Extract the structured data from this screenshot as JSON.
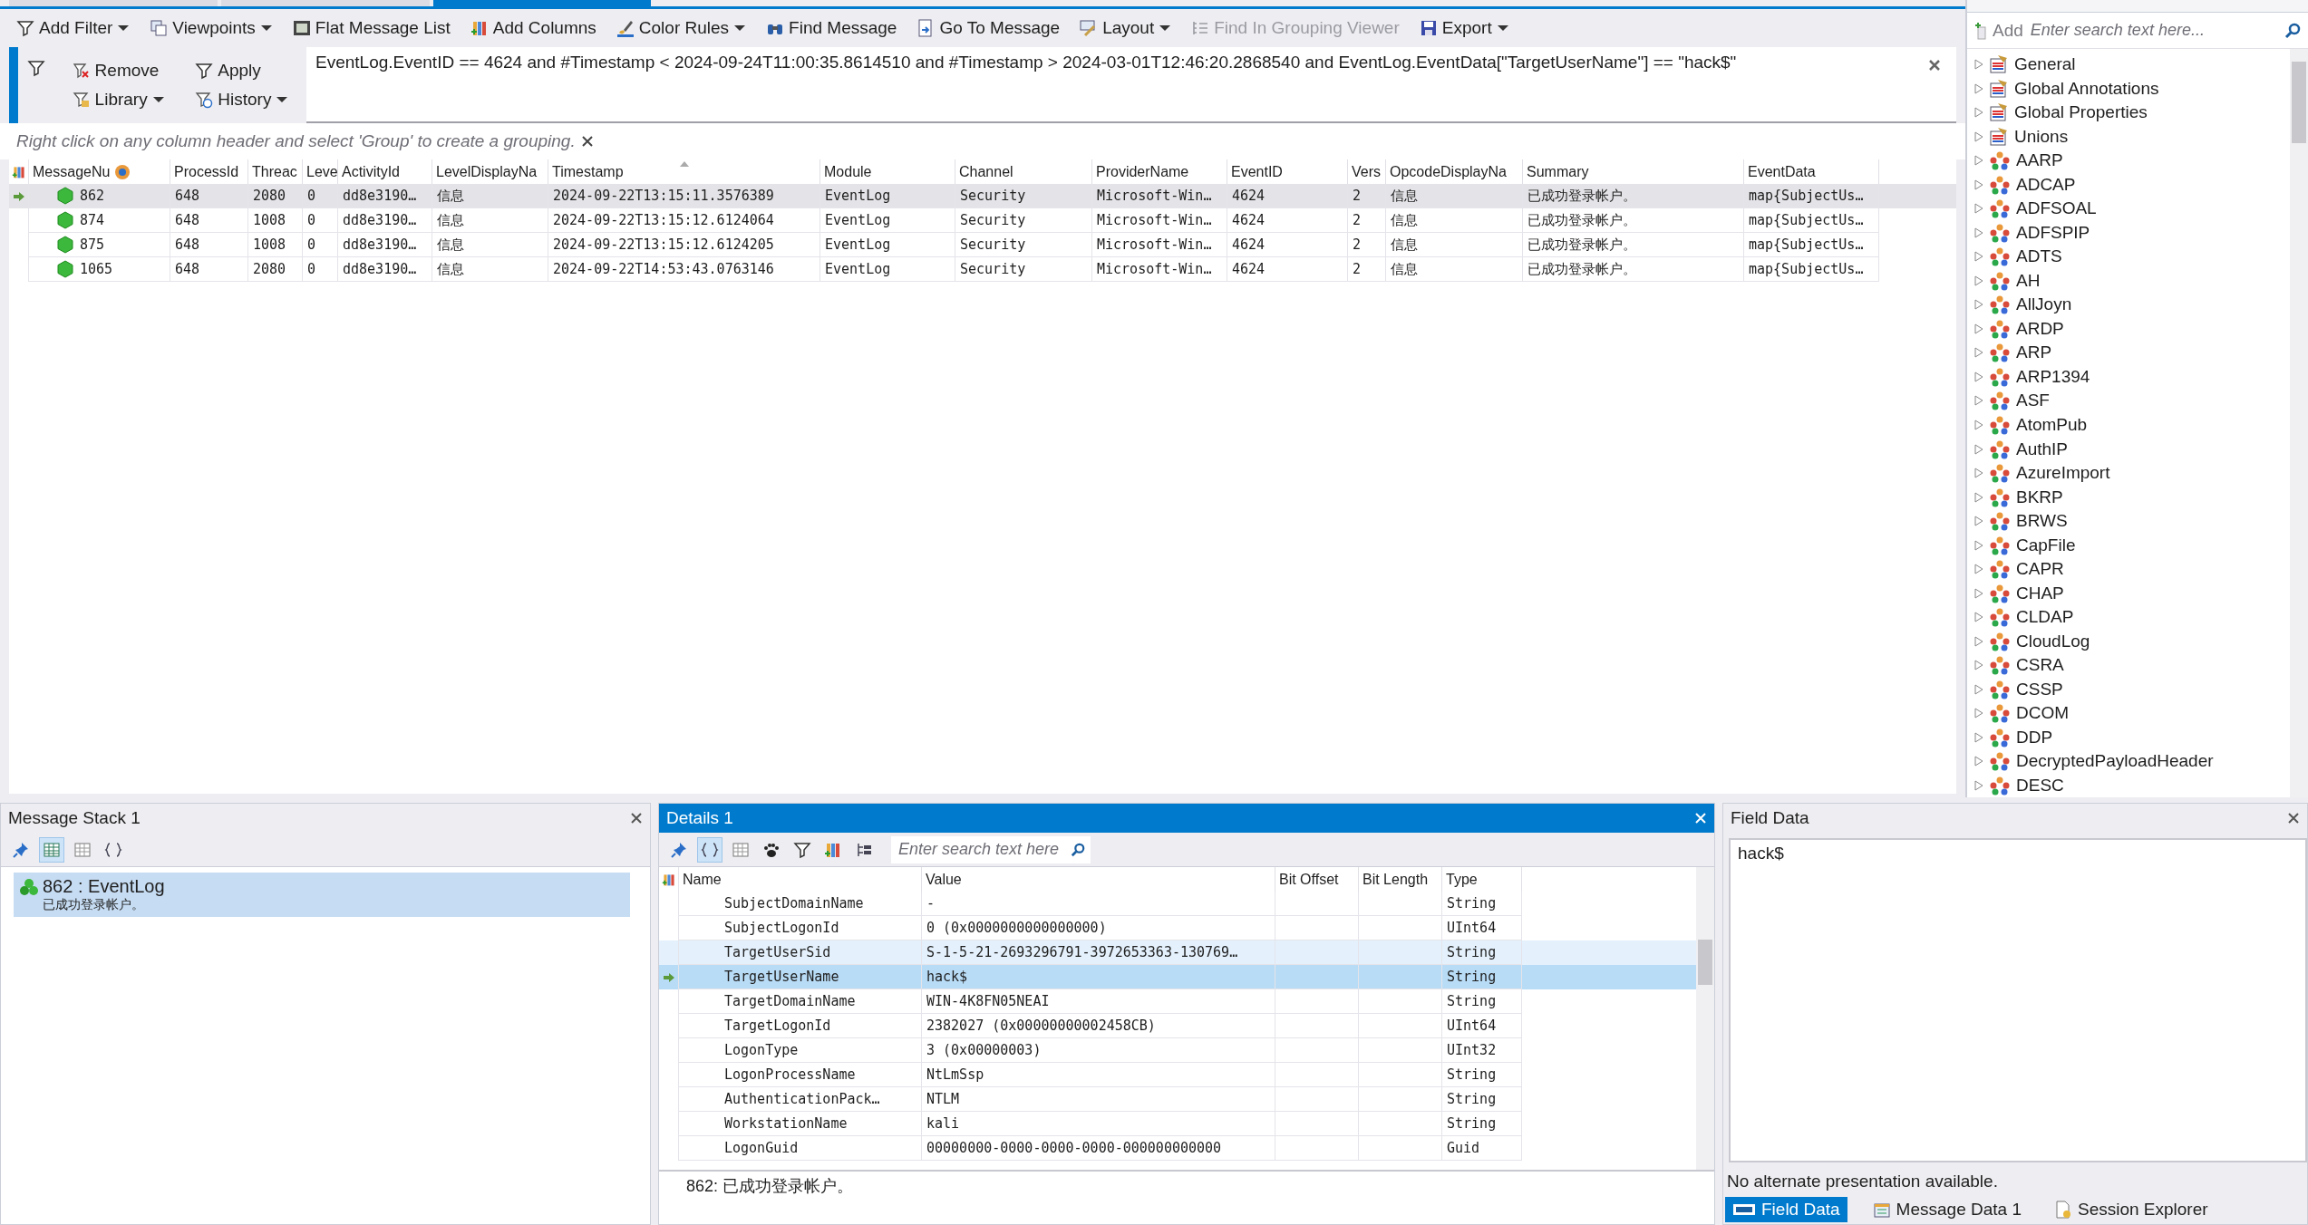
{
  "document_tabs": [
    {
      "selected": false
    },
    {
      "selected": false
    },
    {
      "selected": true
    }
  ],
  "toolbar": {
    "items": [
      {
        "label": "Add Filter",
        "dropdown": true,
        "disabled": false
      },
      {
        "label": "Viewpoints",
        "dropdown": true,
        "disabled": false
      },
      {
        "label": "Flat Message List",
        "dropdown": false,
        "disabled": false
      },
      {
        "label": "Add Columns",
        "dropdown": false,
        "disabled": false
      },
      {
        "label": "Color Rules",
        "dropdown": true,
        "disabled": false
      },
      {
        "label": "Find Message",
        "dropdown": false,
        "disabled": false
      },
      {
        "label": "Go To Message",
        "dropdown": false,
        "disabled": false
      },
      {
        "label": "Layout",
        "dropdown": true,
        "disabled": false
      },
      {
        "label": "Find In Grouping Viewer",
        "dropdown": false,
        "disabled": true
      },
      {
        "label": "Export",
        "dropdown": true,
        "disabled": false
      }
    ]
  },
  "filter_panel": {
    "buttons": [
      {
        "label": "Remove",
        "dropdown": false
      },
      {
        "label": "Apply",
        "dropdown": false
      },
      {
        "label": "Library",
        "dropdown": true
      },
      {
        "label": "History",
        "dropdown": true
      }
    ],
    "expression": "EventLog.EventID == 4624 and #Timestamp < 2024-09-24T11:00:35.8614510 and #Timestamp > 2024-03-01T12:46:20.2868540 and EventLog.EventData[\"TargetUserName\"] == \"hack$\""
  },
  "grouping_hint": "Right click on any column header and select 'Group' to create a grouping.",
  "message_table": {
    "columns": [
      {
        "label": "MessageNu",
        "sorted": false
      },
      {
        "label": "ProcessId",
        "sorted": false
      },
      {
        "label": "Threac",
        "sorted": false
      },
      {
        "label": "Leve",
        "sorted": false
      },
      {
        "label": "ActivityId",
        "sorted": false
      },
      {
        "label": "LevelDisplayNa",
        "sorted": false
      },
      {
        "label": "Timestamp",
        "sorted": true
      },
      {
        "label": "Module",
        "sorted": false
      },
      {
        "label": "Channel",
        "sorted": false
      },
      {
        "label": "ProviderName",
        "sorted": false
      },
      {
        "label": "EventID",
        "sorted": false
      },
      {
        "label": "Vers",
        "sorted": false
      },
      {
        "label": "OpcodeDisplayNa",
        "sorted": false
      },
      {
        "label": "Summary",
        "sorted": false
      },
      {
        "label": "EventData",
        "sorted": false
      }
    ],
    "rows": [
      {
        "selected": true,
        "cells": [
          "862",
          "648",
          "2080",
          "0",
          "dd8e3190…",
          "信息",
          "2024-09-22T13:15:11.3576389",
          "EventLog",
          "Security",
          "Microsoft-Win…",
          "4624",
          "2",
          "信息",
          "已成功登录帐户。",
          "map{SubjectUs…"
        ]
      },
      {
        "selected": false,
        "cells": [
          "874",
          "648",
          "1008",
          "0",
          "dd8e3190…",
          "信息",
          "2024-09-22T13:15:12.6124064",
          "EventLog",
          "Security",
          "Microsoft-Win…",
          "4624",
          "2",
          "信息",
          "已成功登录帐户。",
          "map{SubjectUs…"
        ]
      },
      {
        "selected": false,
        "cells": [
          "875",
          "648",
          "1008",
          "0",
          "dd8e3190…",
          "信息",
          "2024-09-22T13:15:12.6124205",
          "EventLog",
          "Security",
          "Microsoft-Win…",
          "4624",
          "2",
          "信息",
          "已成功登录帐户。",
          "map{SubjectUs…"
        ]
      },
      {
        "selected": false,
        "cells": [
          "1065",
          "648",
          "2080",
          "0",
          "dd8e3190…",
          "信息",
          "2024-09-22T14:53:43.0763146",
          "EventLog",
          "Security",
          "Microsoft-Win…",
          "4624",
          "2",
          "信息",
          "已成功登录帐户。",
          "map{SubjectUs…"
        ]
      }
    ]
  },
  "field_chooser": {
    "add_button": "Add",
    "search": {
      "placeholder": "Enter search text here..."
    },
    "items": [
      {
        "label": "General",
        "kind": "group"
      },
      {
        "label": "Global Annotations",
        "kind": "group"
      },
      {
        "label": "Global Properties",
        "kind": "group"
      },
      {
        "label": "Unions",
        "kind": "group"
      },
      {
        "label": "AARP",
        "kind": "protocol"
      },
      {
        "label": "ADCAP",
        "kind": "protocol"
      },
      {
        "label": "ADFSOAL",
        "kind": "protocol"
      },
      {
        "label": "ADFSPIP",
        "kind": "protocol"
      },
      {
        "label": "ADTS",
        "kind": "protocol"
      },
      {
        "label": "AH",
        "kind": "protocol"
      },
      {
        "label": "AllJoyn",
        "kind": "protocol"
      },
      {
        "label": "ARDP",
        "kind": "protocol"
      },
      {
        "label": "ARP",
        "kind": "protocol"
      },
      {
        "label": "ARP1394",
        "kind": "protocol"
      },
      {
        "label": "ASF",
        "kind": "protocol"
      },
      {
        "label": "AtomPub",
        "kind": "protocol"
      },
      {
        "label": "AuthIP",
        "kind": "protocol"
      },
      {
        "label": "AzureImport",
        "kind": "protocol"
      },
      {
        "label": "BKRP",
        "kind": "protocol"
      },
      {
        "label": "BRWS",
        "kind": "protocol"
      },
      {
        "label": "CapFile",
        "kind": "protocol"
      },
      {
        "label": "CAPR",
        "kind": "protocol"
      },
      {
        "label": "CHAP",
        "kind": "protocol"
      },
      {
        "label": "CLDAP",
        "kind": "protocol"
      },
      {
        "label": "CloudLog",
        "kind": "protocol"
      },
      {
        "label": "CSRA",
        "kind": "protocol"
      },
      {
        "label": "CSSP",
        "kind": "protocol"
      },
      {
        "label": "DCOM",
        "kind": "protocol"
      },
      {
        "label": "DDP",
        "kind": "protocol"
      },
      {
        "label": "DecryptedPayloadHeader",
        "kind": "protocol"
      },
      {
        "label": "DESC",
        "kind": "protocol"
      }
    ]
  },
  "message_stack": {
    "title": "Message Stack 1",
    "tools": [
      {
        "selected": false
      },
      {
        "selected": true
      },
      {
        "selected": false
      },
      {
        "selected": false
      }
    ],
    "items": [
      {
        "title": "862 : EventLog",
        "summary": "已成功登录帐户。",
        "selected": true
      }
    ]
  },
  "details": {
    "title": "Details 1",
    "tools": [
      {
        "selected": false
      },
      {
        "selected": true
      },
      {
        "selected": false
      },
      {
        "selected": false
      },
      {
        "selected": false
      },
      {
        "selected": false
      },
      {
        "selected": false
      }
    ],
    "search": {
      "placeholder": "Enter search text here"
    },
    "columns": [
      "Name",
      "Value",
      "Bit Offset",
      "Bit Length",
      "Type"
    ],
    "rows": [
      {
        "name": "SubjectDomainName",
        "value": "-",
        "type": "String",
        "selected": false,
        "highlighted": false
      },
      {
        "name": "SubjectLogonId",
        "value": "0 (0x0000000000000000)",
        "type": "UInt64",
        "selected": false,
        "highlighted": false
      },
      {
        "name": "TargetUserSid",
        "value": "S-1-5-21-2693296791-3972653363-130769…",
        "type": "String",
        "selected": false,
        "highlighted": true
      },
      {
        "name": "TargetUserName",
        "value": "hack$",
        "type": "String",
        "selected": true,
        "highlighted": false
      },
      {
        "name": "TargetDomainName",
        "value": "WIN-4K8FN05NEAI",
        "type": "String",
        "selected": false,
        "highlighted": false
      },
      {
        "name": "TargetLogonId",
        "value": "2382027 (0x00000000002458CB)",
        "type": "UInt64",
        "selected": false,
        "highlighted": false
      },
      {
        "name": "LogonType",
        "value": "3 (0x00000003)",
        "type": "UInt32",
        "selected": false,
        "highlighted": false
      },
      {
        "name": "LogonProcessName",
        "value": "NtLmSsp",
        "type": "String",
        "selected": false,
        "highlighted": false
      },
      {
        "name": "AuthenticationPack…",
        "value": "NTLM",
        "type": "String",
        "selected": false,
        "highlighted": false
      },
      {
        "name": "WorkstationName",
        "value": "kali",
        "type": "String",
        "selected": false,
        "highlighted": false
      },
      {
        "name": "LogonGuid",
        "value": "00000000-0000-0000-0000-000000000000",
        "type": "Guid",
        "selected": false,
        "highlighted": false
      }
    ],
    "description": "862: 已成功登录帐户。"
  },
  "field_data": {
    "title": "Field Data",
    "value": "hack$",
    "note": "No alternate presentation available.",
    "tabs": [
      {
        "label": "Field Data",
        "selected": true
      },
      {
        "label": "Message Data 1",
        "selected": false
      },
      {
        "label": "Session Explorer",
        "selected": false
      }
    ]
  }
}
